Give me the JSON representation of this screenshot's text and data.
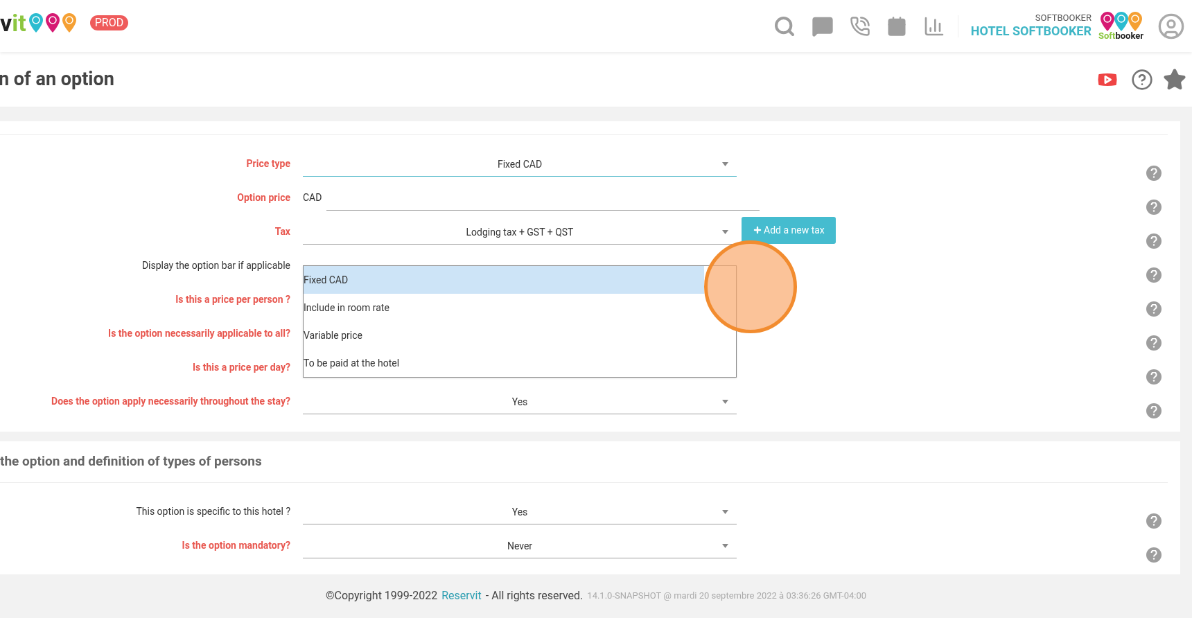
{
  "header": {
    "logo_text": "vit",
    "env_badge": "PROD",
    "account_name": "SOFTBOOKER",
    "hotel_name": "HOTEL SOFTBOOKER",
    "brand_text": [
      "Soft",
      "booker"
    ]
  },
  "page_title": "n of an option",
  "form": {
    "rows": [
      {
        "label": "Price type",
        "required": true,
        "kind": "select",
        "value": "Fixed CAD",
        "focused": true
      },
      {
        "label": "Option price",
        "required": true,
        "kind": "text",
        "prefix": "CAD"
      },
      {
        "label": "Tax",
        "required": true,
        "kind": "select",
        "value": "Lodging tax + GST + QST",
        "focused": false,
        "action": "Add a new tax"
      },
      {
        "label": "Display the option bar if applicable",
        "required": false,
        "kind": "hidden"
      },
      {
        "label": "Is this a price per person ?",
        "required": true,
        "kind": "hidden"
      },
      {
        "label": "Is the option necessarily applicable to all?",
        "required": true,
        "kind": "hidden"
      },
      {
        "label": "Is this a price per day?",
        "required": true,
        "kind": "hidden"
      },
      {
        "label": "Does the option apply necessarily throughout the stay?",
        "required": true,
        "kind": "select",
        "value": "Yes",
        "focused": false
      }
    ],
    "dropdown": [
      {
        "label": "Fixed CAD",
        "selected": true
      },
      {
        "label": "Include in room rate",
        "selected": false
      },
      {
        "label": "Variable price",
        "selected": false
      },
      {
        "label": "To be paid at the hotel",
        "selected": false
      }
    ]
  },
  "section2": {
    "heading": "the option and definition of types of persons",
    "rows": [
      {
        "label": "This option is specific to this hotel ?",
        "required": false,
        "kind": "select",
        "value": "Yes",
        "focused": false
      },
      {
        "label": "Is the option mandatory?",
        "required": true,
        "kind": "select",
        "value": "Never",
        "focused": false
      }
    ]
  },
  "footer": {
    "copyright": "©Copyright 1999-2022",
    "link": "Reservit",
    "rights": "- All rights reserved.",
    "version": "14.1.0-SNAPSHOT @ mardi 20 septembre 2022 à 03:36:26 GMT-04:00"
  }
}
